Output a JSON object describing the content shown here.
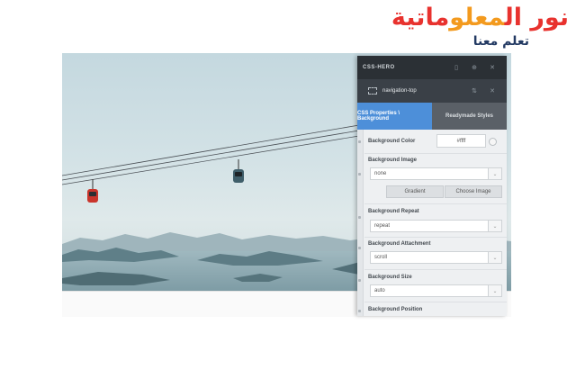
{
  "logo": {
    "name_part1": "نور ال",
    "name_part2": "معلو",
    "name_part3": "ماتية",
    "tagline": "تعلم معنا"
  },
  "panel": {
    "title": "CSS-HERO",
    "selector": "navigation-top",
    "tabs": [
      {
        "label": "CSS Properties \\ Background",
        "active": true
      },
      {
        "label": "Readymade Styles",
        "active": false
      }
    ],
    "properties": {
      "bg_color_label": "Background Color",
      "bg_color_value": "#ffff",
      "bg_image_label": "Background Image",
      "bg_image_value": "none",
      "gradient_button": "Gradient",
      "choose_image_button": "Choose Image",
      "bg_repeat_label": "Background Repeat",
      "bg_repeat_value": "repeat",
      "bg_attachment_label": "Background Attachment",
      "bg_attachment_value": "scroll",
      "bg_size_label": "Background Size",
      "bg_size_value": "auto",
      "bg_position_label": "Background Position"
    }
  },
  "colors": {
    "panel_header": "#2b3035",
    "active_tab": "#4d8fd9",
    "logo_red": "#e8322e",
    "logo_orange": "#f39a1e",
    "logo_navy": "#233a63"
  },
  "icons": [
    "phone-icon",
    "move-icon",
    "close-icon",
    "selector-icon",
    "drag-icon",
    "reset-circle-icon",
    "dropdown-arrow-icon"
  ]
}
